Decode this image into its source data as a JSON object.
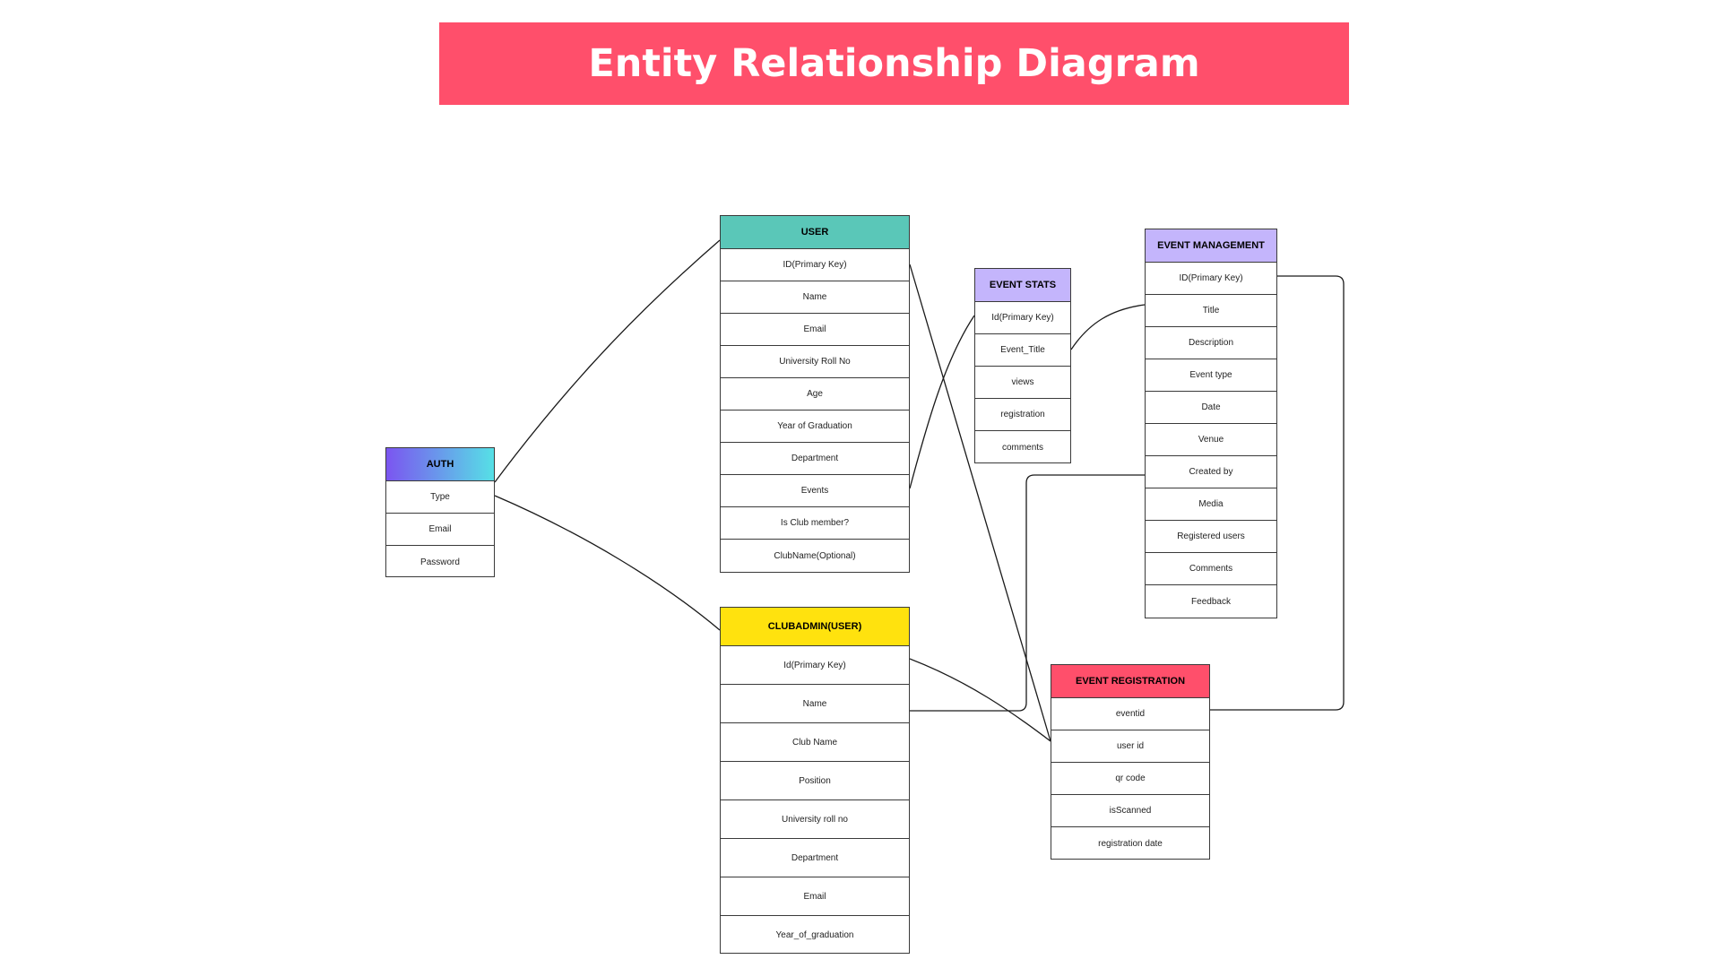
{
  "title": "Entity Relationship Diagram",
  "colors": {
    "banner": "#ff4f6b",
    "user": "#5ac7b8",
    "auth_gradient": [
      "#7b55f0",
      "#56e0e6"
    ],
    "clubadmin": "#ffe20e",
    "event_stats": "#c4b5fc",
    "event_management": "#c4b5fc",
    "event_registration": "#ff4f6b"
  },
  "entities": {
    "auth": {
      "name": "AUTH",
      "fields": [
        "Type",
        "Email",
        "Password"
      ]
    },
    "user": {
      "name": "USER",
      "fields": [
        "ID(Primary Key)",
        "Name",
        "Email",
        "University Roll No",
        "Age",
        "Year of Graduation",
        "Department",
        "Events",
        "Is Club member?",
        "ClubName(Optional)"
      ]
    },
    "clubadmin": {
      "name": "CLUBADMIN(USER)",
      "fields": [
        "Id(Primary Key)",
        "Name",
        "Club Name",
        "Position",
        "University roll no",
        "Department",
        "Email",
        "Year_of_graduation"
      ]
    },
    "event_stats": {
      "name": "EVENT STATS",
      "fields": [
        "Id(Primary Key)",
        "Event_Title",
        "views",
        "registration",
        "comments"
      ]
    },
    "event_management": {
      "name": "EVENT MANAGEMENT",
      "fields": [
        "ID(Primary Key)",
        "Title",
        "Description",
        "Event type",
        "Date",
        "Venue",
        "Created by",
        "Media",
        "Registered users",
        "Comments",
        "Feedback"
      ]
    },
    "event_registration": {
      "name": "EVENT REGISTRATION",
      "fields": [
        "eventid",
        "user id",
        "qr code",
        "isScanned",
        "registration date"
      ]
    }
  }
}
